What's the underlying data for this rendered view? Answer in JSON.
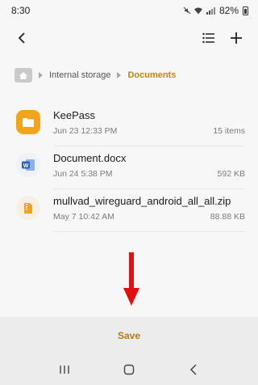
{
  "status_bar": {
    "time": "8:30",
    "battery": "82%"
  },
  "breadcrumb": {
    "items": [
      "Internal storage",
      "Documents"
    ]
  },
  "files": [
    {
      "name": "KeePass",
      "date": "Jun 23 12:33 PM",
      "size": "15 items",
      "icon": "folder-icon"
    },
    {
      "name": "Document.docx",
      "date": "Jun 24 5:38 PM",
      "size": "592 KB",
      "icon": "word-document-icon"
    },
    {
      "name": "mullvad_wireguard_android_all_all.zip",
      "date": "May 7 10:42 AM",
      "size": "88.88 KB",
      "icon": "zip-archive-icon"
    }
  ],
  "save_bar": {
    "save_label": "Save"
  },
  "colors": {
    "accent": "#c5860b",
    "save_text": "#b47a0f",
    "arrow": "#e01010",
    "folder": "#f0a51c",
    "word": "#2b5fc6"
  }
}
